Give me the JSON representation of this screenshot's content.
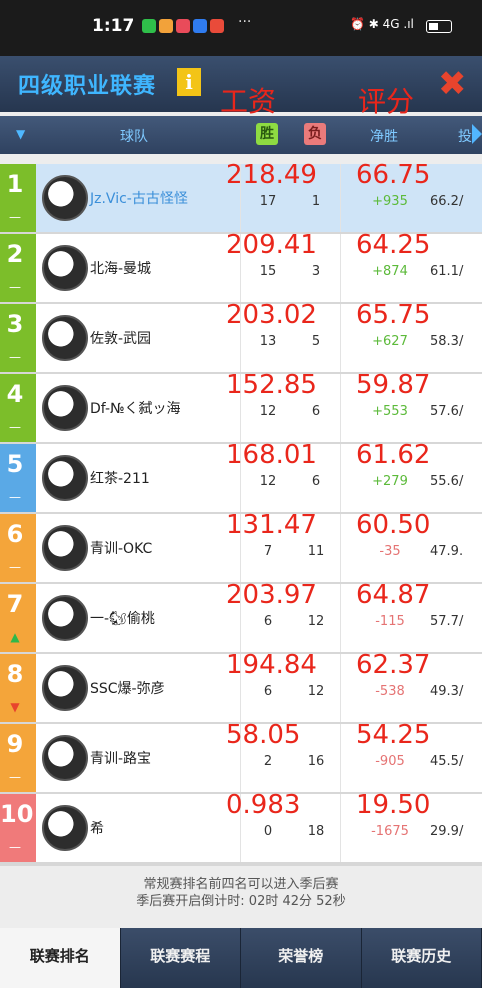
{
  "status_bar": {
    "time": "1:17",
    "more": "···",
    "system_icons": "⏰ ✱ 4G .ıl"
  },
  "title_bar": {
    "title": "四级职业联赛",
    "info_icon": "i",
    "close_icon": "✖"
  },
  "overlay_labels": {
    "salary": "工资",
    "score": "评分"
  },
  "table_header": {
    "sort_icon": "▼",
    "team": "球队",
    "wins": "胜",
    "losses": "负",
    "net": "净胜",
    "more": "投"
  },
  "rows": [
    {
      "rank": "1",
      "trend": "—",
      "name": "Jz.Vic-古古怪怪",
      "wins": "17",
      "losses": "1",
      "net": "+935",
      "rate": "66.2/",
      "salary": "218.49",
      "score": "66.75"
    },
    {
      "rank": "2",
      "trend": "—",
      "name": "北海-曼城",
      "wins": "15",
      "losses": "3",
      "net": "+874",
      "rate": "61.1/",
      "salary": "209.41",
      "score": "64.25"
    },
    {
      "rank": "3",
      "trend": "—",
      "name": "佐敦-武园",
      "wins": "13",
      "losses": "5",
      "net": "+627",
      "rate": "58.3/",
      "salary": "203.02",
      "score": "65.75"
    },
    {
      "rank": "4",
      "trend": "—",
      "name": "Df-№く弑ッ海",
      "wins": "12",
      "losses": "6",
      "net": "+553",
      "rate": "57.6/",
      "salary": "152.85",
      "score": "59.87"
    },
    {
      "rank": "5",
      "trend": "—",
      "name": "红茶-211",
      "wins": "12",
      "losses": "6",
      "net": "+279",
      "rate": "55.6/",
      "salary": "168.01",
      "score": "61.62"
    },
    {
      "rank": "6",
      "trend": "—",
      "name": "青训-OKC",
      "wins": "7",
      "losses": "11",
      "net": "-35",
      "rate": "47.9.",
      "salary": "131.47",
      "score": "60.50"
    },
    {
      "rank": "7",
      "trend": "▲",
      "name": "一-🐿偷桃",
      "wins": "6",
      "losses": "12",
      "net": "-115",
      "rate": "57.7/",
      "salary": "203.97",
      "score": "64.87"
    },
    {
      "rank": "8",
      "trend": "▼",
      "name": "SSC爆-弥彦",
      "wins": "6",
      "losses": "12",
      "net": "-538",
      "rate": "49.3/",
      "salary": "194.84",
      "score": "62.37"
    },
    {
      "rank": "9",
      "trend": "—",
      "name": "青训-路宝",
      "wins": "2",
      "losses": "16",
      "net": "-905",
      "rate": "45.5/",
      "salary": "58.05",
      "score": "54.25"
    },
    {
      "rank": "10",
      "trend": "—",
      "name": "希",
      "wins": "0",
      "losses": "18",
      "net": "-1675",
      "rate": "29.9/",
      "salary": "0.983",
      "score": "19.50"
    }
  ],
  "notice": {
    "line1": "常规赛排名前四名可以进入季后赛",
    "line2": "季后赛开启倒计时: 02时 42分 52秒"
  },
  "tabs": [
    "联赛排名",
    "联赛赛程",
    "荣誉榜",
    "联赛历史"
  ],
  "colors": {
    "rank_green": "#7cbe2a",
    "rank_blue": "#5aa9e6",
    "rank_orange": "#f4a53a",
    "rank_pink": "#f07a7a",
    "net_pos": "#5cba3a",
    "net_neg": "#e57373",
    "overlay_red": "#e9261b"
  }
}
